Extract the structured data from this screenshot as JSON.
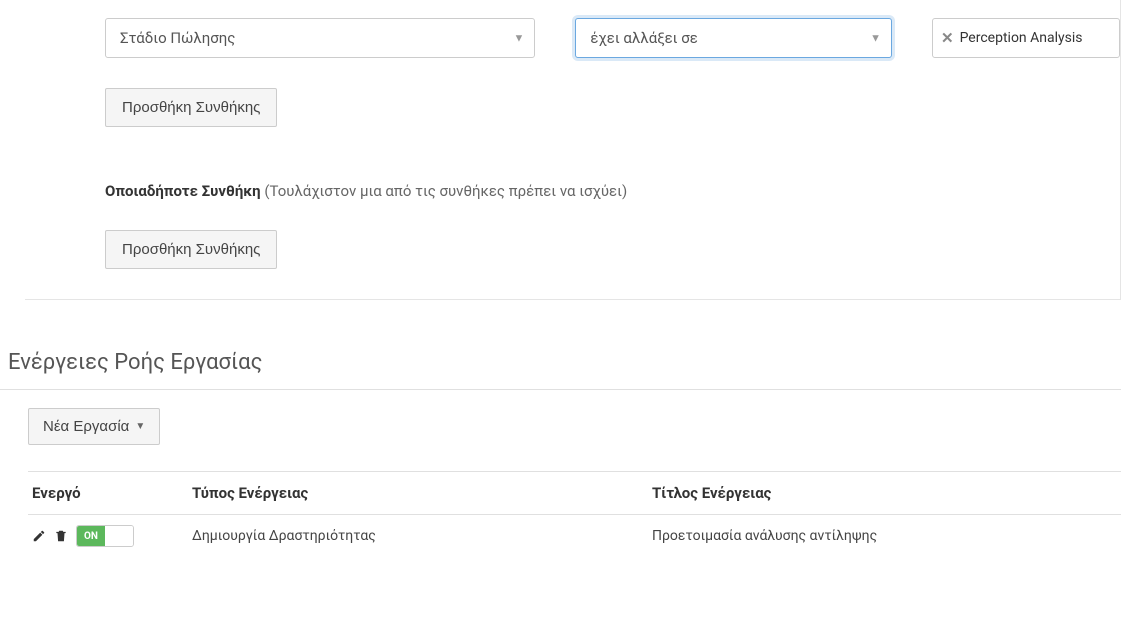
{
  "condition_row": {
    "field_select": "Στάδιο Πώλησης",
    "operator_select": "έχει αλλάξει σε",
    "tag_value": "Perception Analysis"
  },
  "buttons": {
    "add_condition": "Προσθήκη Συνθήκης",
    "new_task": "Νέα Εργασία"
  },
  "any_condition": {
    "label": "Οποιαδήποτε Συνθήκη",
    "hint": "(Τουλάχιστον μια από τις συνθήκες πρέπει να ισχύει)"
  },
  "workflow_actions_heading": "Ενέργειες Ροής Εργασίας",
  "table": {
    "headers": {
      "active": "Ενεργό",
      "action_type": "Τύπος Ενέργειας",
      "action_title": "Τίτλος Ενέργειας"
    },
    "row": {
      "toggle_state": "ON",
      "action_type": "Δημιουργία Δραστηριότητας",
      "action_title": "Προετοιμασία ανάλυσης αντίληψης"
    }
  }
}
